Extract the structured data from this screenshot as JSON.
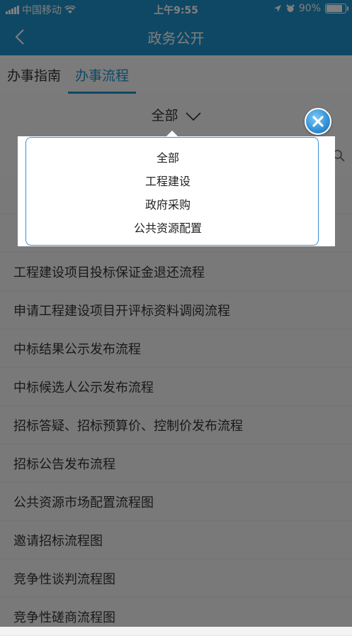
{
  "status_bar": {
    "carrier": "中国移动",
    "time": "上午9:55",
    "battery": "90%"
  },
  "nav": {
    "title": "政务公开"
  },
  "tabs": [
    {
      "label": "办事指南",
      "active": false
    },
    {
      "label": "办事流程",
      "active": true
    }
  ],
  "filter": {
    "selected": "全部"
  },
  "list_items": [
    "工程建设项目投标保证金退还流程",
    "申请工程建设项目开评标资料调阅流程",
    "中标结果公示发布流程",
    "中标候选人公示发布流程",
    "招标答疑、招标预算价、控制价发布流程",
    "招标公告发布流程",
    "公共资源市场配置流程图",
    "邀请招标流程图",
    "竞争性谈判流程图",
    "竞争性磋商流程图"
  ],
  "dropdown": {
    "options": [
      "全部",
      "工程建设",
      "政府采购",
      "公共资源配置"
    ]
  },
  "colors": {
    "accent": "#1e90c8",
    "popup_border": "#3a8fd0"
  },
  "icons": {
    "back": "chevron-left-icon",
    "close": "close-icon",
    "dropdown": "chevron-down-icon"
  }
}
